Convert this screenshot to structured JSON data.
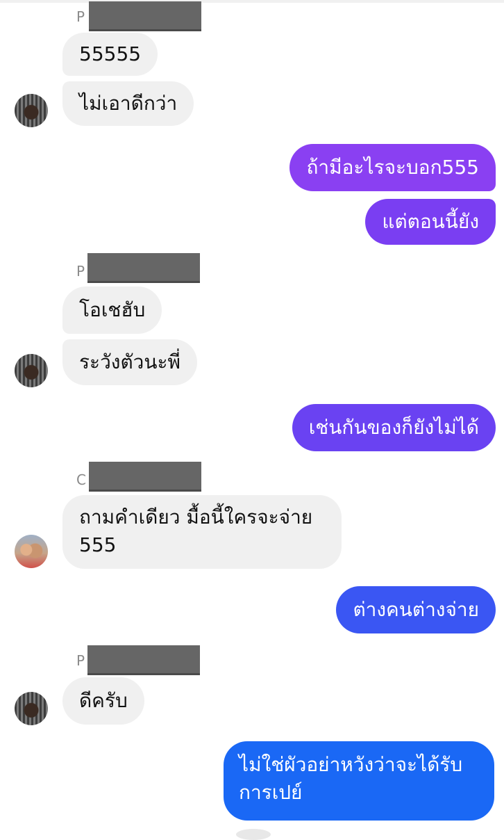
{
  "conversation": {
    "group1": {
      "sender_initial": "P",
      "messages": [
        "55555",
        "ไม่เอาดีกว่า"
      ]
    },
    "out1": {
      "messages": [
        "ถ้ามีอะไรจะบอก555",
        "แต่ตอนนี้ยัง"
      ]
    },
    "group2": {
      "sender_initial": "P",
      "messages": [
        "โอเชฮับ",
        "ระวังตัวนะพี่"
      ]
    },
    "out2": {
      "messages": [
        "เช่นกันของก็ยังไม่ได้"
      ]
    },
    "group3": {
      "sender_initial": "C",
      "message_line1": "ถามคำเดียว มื้อนี้ใครจะจ่าย",
      "message_line2": "555"
    },
    "out3": {
      "messages": [
        "ต่างคนต่างจ่าย"
      ]
    },
    "group4": {
      "sender_initial": "P",
      "messages": [
        "ดีครับ"
      ]
    },
    "out4": {
      "line1": "ไม่ใช่ผัวอย่าหวังว่าจะได้รับ",
      "line2": "การเปย์"
    }
  },
  "colors": {
    "incoming_bubble": "#f0f0f0",
    "outgoing_purple": "#8a40f2",
    "outgoing_violet": "#6a42f2",
    "outgoing_indigo": "#4a4cf2",
    "outgoing_blue": "#2c5ef4",
    "outgoing_bright_blue": "#1a68f5",
    "redaction": "#666666"
  }
}
